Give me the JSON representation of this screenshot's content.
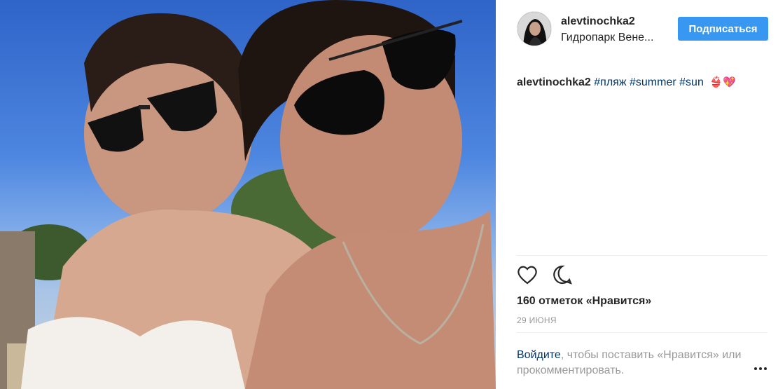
{
  "post": {
    "username": "alevtinochka2",
    "location": "Гидропарк Вене...",
    "follow_label": "Подписаться",
    "caption": {
      "username": "alevtinochka2",
      "tags": [
        "#пляж",
        "#summer",
        "#sun"
      ],
      "emoji": "👙💖"
    },
    "likes": "160 отметок «Нравится»",
    "date": "29 ИЮНЯ",
    "login_link": "Войдите",
    "login_text": ", чтобы поставить «Нравится» или прокомментировать."
  },
  "icons": {
    "like": "heart-icon",
    "comment": "comment-icon",
    "more": "more-options-icon"
  },
  "colors": {
    "accent": "#3897f0",
    "link": "#003569",
    "muted": "#999999",
    "text": "#262626"
  }
}
